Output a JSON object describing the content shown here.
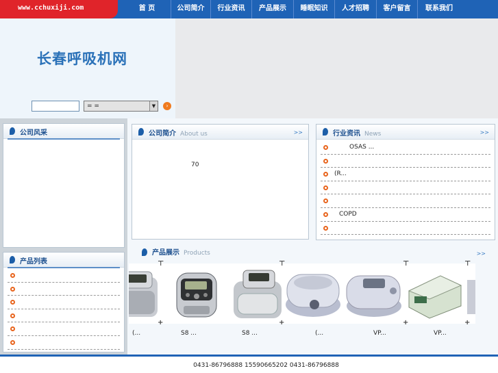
{
  "header": {
    "url_badge": "www.cchuxiji.com",
    "nav": [
      "首 页",
      "公司简介",
      "行业资讯",
      "产品展示",
      "睡眠知识",
      "人才招聘",
      "客户留言",
      "联系我们"
    ]
  },
  "banner": {
    "site_title": "长春呼吸机网",
    "search_value": "",
    "select_value": "= =",
    "select_arrow": "▼",
    "go_glyph": "›"
  },
  "company_style": {
    "title": "公司风采"
  },
  "product_list": {
    "title": "产品列表",
    "items": [
      "",
      "",
      "",
      "",
      "",
      ""
    ]
  },
  "about": {
    "title": "公司简介",
    "subtitle": "About us",
    "more": ">>",
    "text": "70"
  },
  "news": {
    "title": "行业资讯",
    "subtitle": "News",
    "more": ">>",
    "items": [
      "OSAS          ...",
      "",
      "                (R...",
      "",
      "",
      "COPD",
      ""
    ]
  },
  "products": {
    "title": "产品展示",
    "subtitle": "Products",
    "more": ">>",
    "captions": [
      "(...",
      "S8      ...",
      "S8      ...",
      "(...",
      "VP...",
      "VP..."
    ]
  },
  "footer": {
    "text": "0431-86796888 15590665202      0431-86796888"
  },
  "colors": {
    "nav_blue": "#1f63b6",
    "badge_red": "#e0242a",
    "title_blue": "#2a71b8",
    "bullet_orange": "#e8641c"
  }
}
